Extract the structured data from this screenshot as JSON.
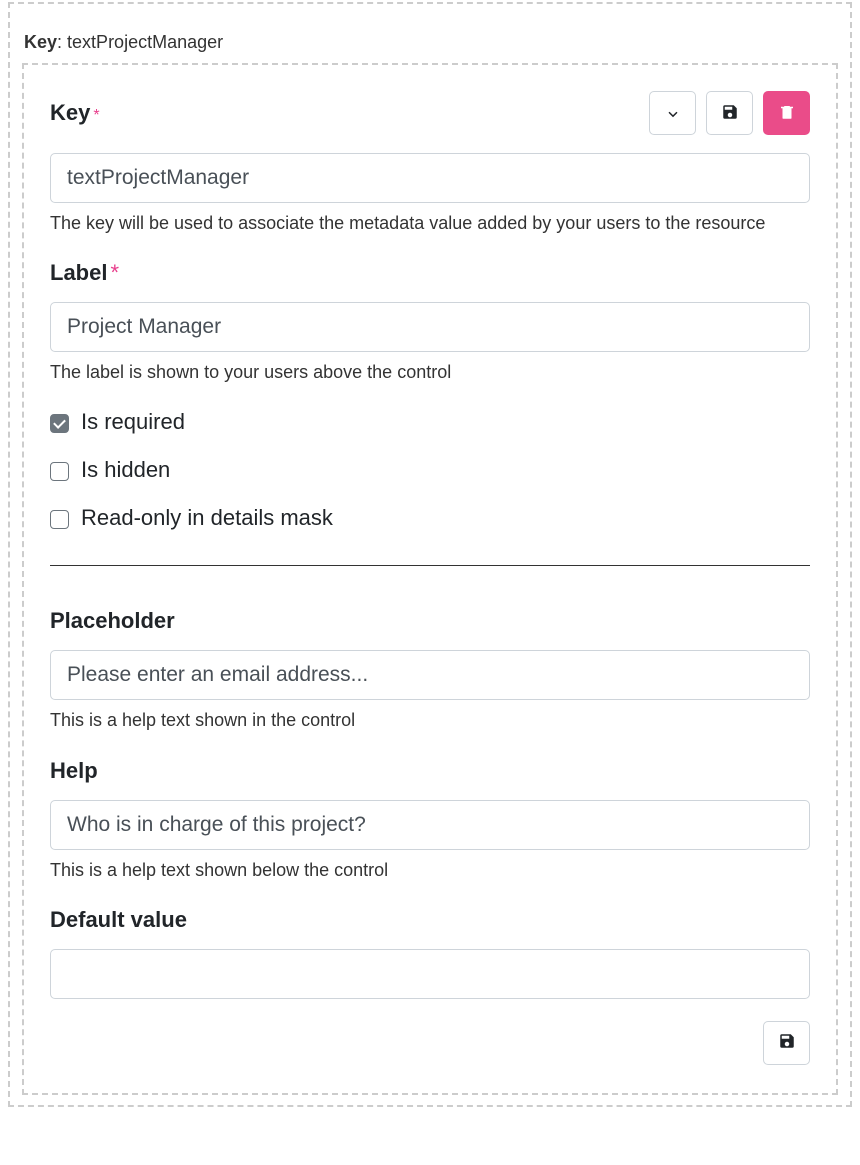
{
  "header": {
    "key_label": "Key",
    "key_value": "textProjectManager"
  },
  "fields": {
    "key": {
      "label": "Key",
      "required": "*",
      "value": "textProjectManager",
      "help": "The key will be used to associate the metadata value added by your users to the resource"
    },
    "label": {
      "label": "Label",
      "required": "*",
      "value": "Project Manager",
      "help": "The label is shown to your users above the control"
    },
    "placeholder": {
      "label": "Placeholder",
      "value": "Please enter an email address...",
      "help": "This is a help text shown in the control"
    },
    "help": {
      "label": "Help",
      "value": "Who is in charge of this project?",
      "help_below": "This is a help text shown below the control"
    },
    "default": {
      "label": "Default value",
      "value": ""
    }
  },
  "checkboxes": {
    "required": {
      "label": "Is required",
      "checked": true
    },
    "hidden": {
      "label": "Is hidden",
      "checked": false
    },
    "readonly": {
      "label": "Read-only in details mask",
      "checked": false
    }
  }
}
